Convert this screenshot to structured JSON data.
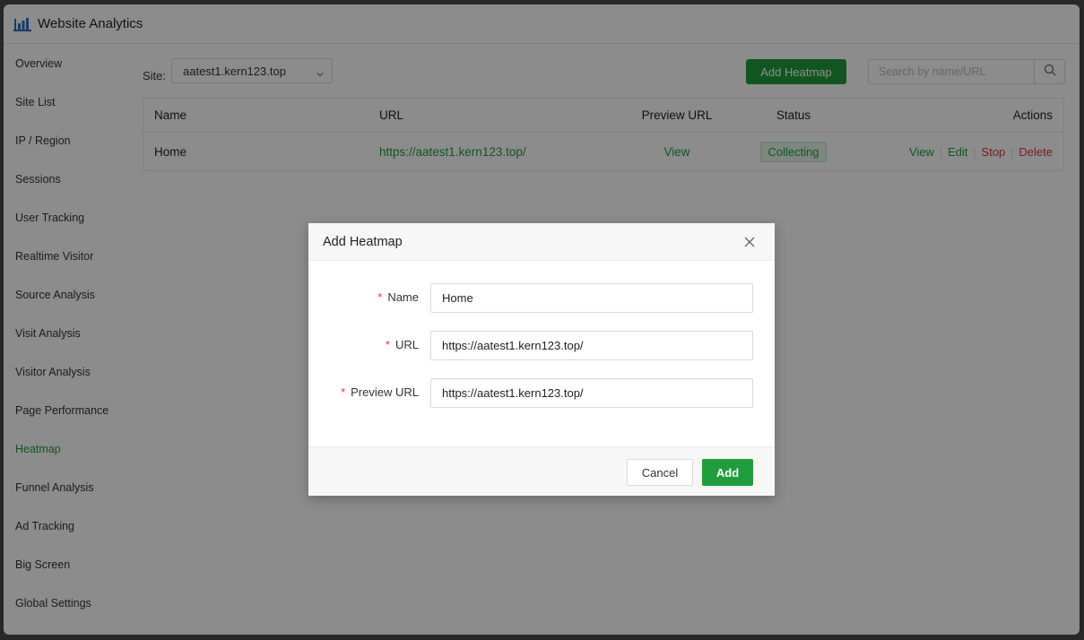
{
  "app": {
    "title": "Website Analytics",
    "icon": "bar-chart-icon",
    "accent": "#1f9d3c"
  },
  "sidebar": {
    "items": [
      {
        "label": "Overview"
      },
      {
        "label": "Site List"
      },
      {
        "label": "IP / Region"
      },
      {
        "label": "Sessions"
      },
      {
        "label": "User Tracking"
      },
      {
        "label": "Realtime Visitor"
      },
      {
        "label": "Source Analysis"
      },
      {
        "label": "Visit Analysis"
      },
      {
        "label": "Visitor Analysis"
      },
      {
        "label": "Page Performance"
      },
      {
        "label": "Heatmap",
        "active": true
      },
      {
        "label": "Funnel Analysis"
      },
      {
        "label": "Ad Tracking"
      },
      {
        "label": "Big Screen"
      },
      {
        "label": "Global Settings"
      }
    ]
  },
  "toolbar": {
    "site_label": "Site:",
    "site_value": "aatest1.kern123.top",
    "add_label": "Add Heatmap",
    "search_placeholder": "Search by name/URL"
  },
  "table": {
    "headers": {
      "name": "Name",
      "url": "URL",
      "preview": "Preview URL",
      "status": "Status",
      "actions": "Actions"
    },
    "rows": [
      {
        "name": "Home",
        "url": "https://aatest1.kern123.top/",
        "preview": "View",
        "status": "Collecting",
        "actions": {
          "view": "View",
          "edit": "Edit",
          "stop": "Stop",
          "delete": "Delete"
        }
      }
    ]
  },
  "modal": {
    "title": "Add Heatmap",
    "fields": {
      "name": {
        "label": "Name",
        "value": "Home"
      },
      "url": {
        "label": "URL",
        "value": "https://aatest1.kern123.top/"
      },
      "preview": {
        "label": "Preview URL",
        "value": "https://aatest1.kern123.top/"
      }
    },
    "required_mark": "*",
    "cancel_label": "Cancel",
    "ok_label": "Add"
  }
}
